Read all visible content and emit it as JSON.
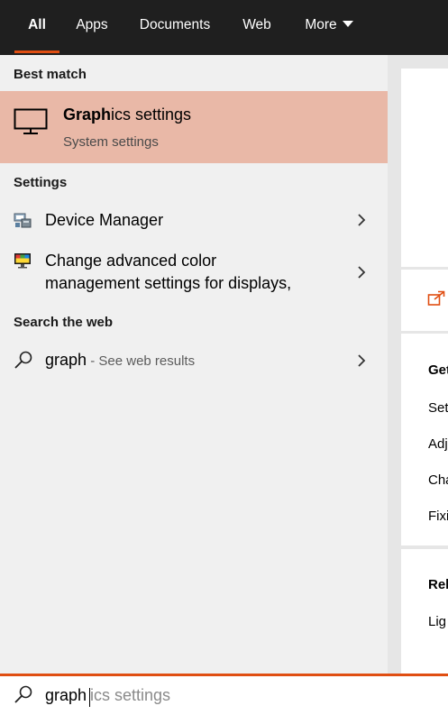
{
  "tabs": [
    {
      "label": "All"
    },
    {
      "label": "Apps"
    },
    {
      "label": "Documents"
    },
    {
      "label": "Web"
    },
    {
      "label": "More"
    }
  ],
  "best_match": {
    "header": "Best match",
    "title_bold": "Graph",
    "title_rest": "ics settings",
    "subtitle": "System settings"
  },
  "settings": {
    "header": "Settings",
    "items": [
      {
        "label": "Device Manager"
      },
      {
        "line1": "Change advanced color",
        "line2": "management settings for displays,"
      }
    ]
  },
  "web": {
    "header": "Search the web",
    "query": "graph",
    "suffix": " - See web results"
  },
  "preview": {
    "get_header": "Get",
    "get_items": [
      "Set",
      "Adj",
      "Cha",
      "Fixi"
    ],
    "related_header": "Rel",
    "related_items": [
      "Lig"
    ]
  },
  "search": {
    "typed": "graph",
    "completion": "ics settings"
  },
  "colors": {
    "accent": "#e04e12",
    "highlight": "#e9b8a7",
    "topbar": "#1f1f1f"
  }
}
